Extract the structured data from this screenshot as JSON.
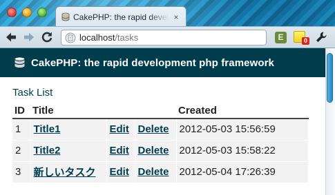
{
  "browser": {
    "tab_title": "CakePHP: the rapid development php framework",
    "tab_close": "×",
    "url_host": "localhost",
    "url_path": "/tasks",
    "notes_badge": "0"
  },
  "site": {
    "title": "CakePHP: the rapid development php framework"
  },
  "page": {
    "heading": "Task List",
    "columns": [
      "ID",
      "Title",
      "",
      "",
      "Created"
    ],
    "rows": [
      {
        "id": "1",
        "title": "Title1",
        "edit": "Edit",
        "delete": "Delete",
        "created": "2012-05-03 15:56:59"
      },
      {
        "id": "2",
        "title": "Title2",
        "edit": "Edit",
        "delete": "Delete",
        "created": "2012-05-03 15:58:22"
      },
      {
        "id": "3",
        "title": "新しいタスク",
        "edit": "Edit",
        "delete": "Delete",
        "created": "2012-05-04 17:26:39"
      }
    ]
  },
  "icons": {
    "back": "arrow-left-icon",
    "forward": "arrow-right-icon",
    "reload": "reload-icon",
    "page": "page-icon",
    "evernote": "evernote-icon",
    "notes": "sticky-note-icon",
    "wrench": "wrench-icon",
    "cake": "cake-icon"
  },
  "colors": {
    "header_bg": "#003d4c",
    "link": "#003d4c",
    "row_bg": "#f2f2f2",
    "scroll_thumb": "#1f86c6"
  }
}
